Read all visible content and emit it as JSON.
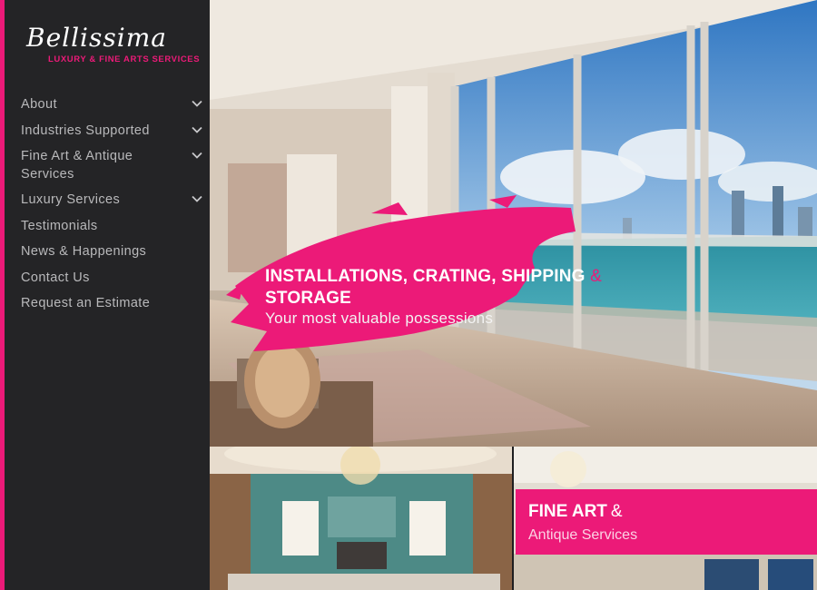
{
  "brand": {
    "name": "Bellissima",
    "tagline": "LUXURY & FINE ARTS SERVICES",
    "accent_color": "#ec1a78"
  },
  "nav": {
    "items": [
      {
        "label": "About",
        "has_submenu": true
      },
      {
        "label": "Industries Supported",
        "has_submenu": true
      },
      {
        "label": "Fine Art & Antique Services",
        "has_submenu": true
      },
      {
        "label": "Luxury Services",
        "has_submenu": true
      },
      {
        "label": "Testimonials",
        "has_submenu": false
      },
      {
        "label": "News & Happenings",
        "has_submenu": false
      },
      {
        "label": "Contact Us",
        "has_submenu": false
      },
      {
        "label": "Request an Estimate",
        "has_submenu": false
      }
    ]
  },
  "hero": {
    "title_main": "INSTALLATIONS, CRATING, SHIPPING",
    "title_amp": "&",
    "title_tail": "STORAGE",
    "subtitle": "Your most valuable possessions"
  },
  "tiles": {
    "fine_art": {
      "title": "FINE ART",
      "amp": "&",
      "subtitle": "Antique Services"
    }
  }
}
